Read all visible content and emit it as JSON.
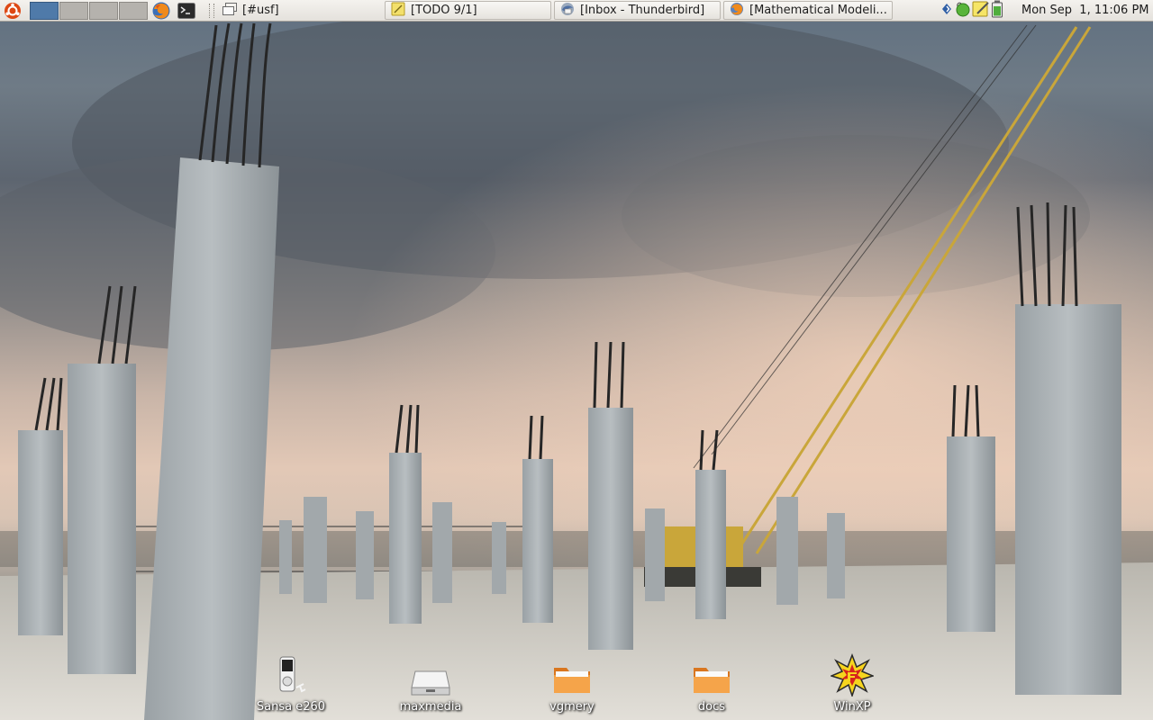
{
  "top_panel": {
    "workspaces": 4,
    "active_workspace": 1,
    "tasks": [
      {
        "label": "[#usf]"
      },
      {
        "label": "[TODO 9/1]"
      },
      {
        "label": "[Inbox - Thunderbird]"
      },
      {
        "label": "[Mathematical Modeli..."
      }
    ],
    "clock": "Mon Sep  1, 11:06 PM"
  },
  "desktop_icons": [
    {
      "label": "Sansa e260",
      "icon": "media-player-icon"
    },
    {
      "label": "maxmedia",
      "icon": "drive-icon"
    },
    {
      "label": "vgmery",
      "icon": "folder-icon"
    },
    {
      "label": "docs",
      "icon": "folder-icon"
    },
    {
      "label": "WinXP",
      "icon": "winxp-starburst-icon"
    }
  ],
  "colors": {
    "panel": "#e9e6e1",
    "active_workspace": "#4f7aa9",
    "folder": "#f29b3b",
    "desktop_label": "#ffffff"
  }
}
